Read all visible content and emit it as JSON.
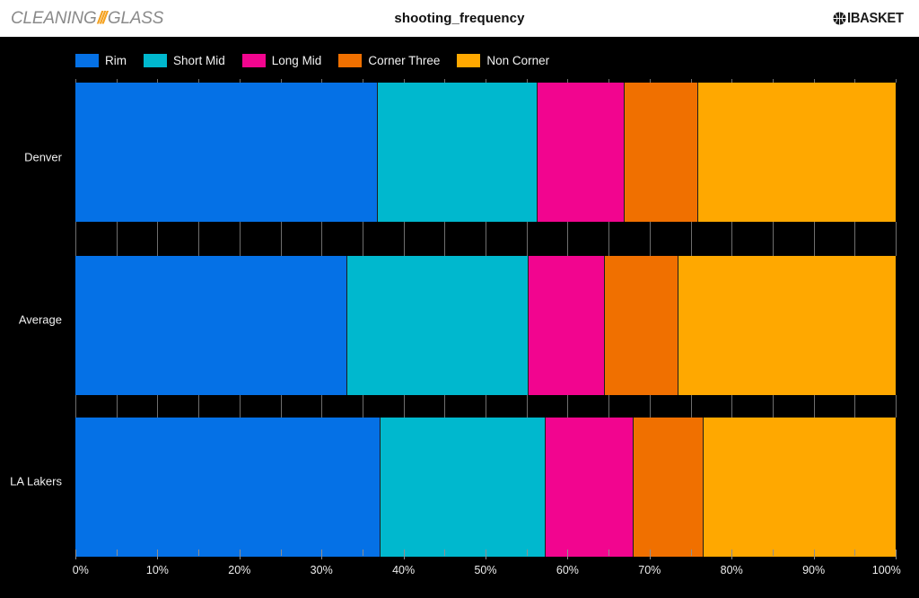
{
  "header": {
    "logo_left": {
      "name": "cleaning-glass-logo",
      "word1": "CLEANING",
      "slashes": "///",
      "word2": "GLASS",
      "slash_color": "#f5a11e",
      "text_color": "#8a8a8a"
    },
    "title": "shooting_frequency",
    "logo_right": {
      "name": "ibasket-logo",
      "icon": "basketball-icon",
      "brand": "IBASKET"
    },
    "background": "#ffffff"
  },
  "legend": {
    "position": "top-left",
    "items": [
      {
        "label": "Rim",
        "color": "#0571e6"
      },
      {
        "label": "Short Mid",
        "color": "#00b8ce"
      },
      {
        "label": "Long Mid",
        "color": "#f2058f"
      },
      {
        "label": "Corner Three",
        "color": "#f07000"
      },
      {
        "label": "Non Corner",
        "color": "#ffa800"
      }
    ]
  },
  "chart_data": {
    "type": "bar",
    "orientation": "horizontal",
    "stacked": true,
    "normalized": true,
    "title": "shooting_frequency",
    "xlabel": "",
    "ylabel": "",
    "xlim": [
      0,
      100
    ],
    "grid": false,
    "background": "#000000",
    "categories": [
      "Denver",
      "Average",
      "LA Lakers"
    ],
    "xtick_labels": [
      "0%",
      "10%",
      "20%",
      "30%",
      "40%",
      "50%",
      "60%",
      "70%",
      "80%",
      "90%",
      "100%"
    ],
    "xtick_values": [
      0,
      10,
      20,
      30,
      40,
      50,
      60,
      70,
      80,
      90,
      100
    ],
    "xtick_minor_values": [
      5,
      15,
      25,
      35,
      45,
      55,
      65,
      75,
      85,
      95
    ],
    "series": [
      {
        "name": "Rim",
        "color": "#0571e6",
        "values": [
          36.9,
          33.2,
          37.2
        ]
      },
      {
        "name": "Short Mid",
        "color": "#00b8ce",
        "values": [
          19.5,
          22.0,
          20.1
        ]
      },
      {
        "name": "Long Mid",
        "color": "#f2058f",
        "values": [
          10.6,
          9.3,
          10.8
        ]
      },
      {
        "name": "Corner Three",
        "color": "#f07000",
        "values": [
          8.9,
          9.0,
          8.5
        ]
      },
      {
        "name": "Non Corner",
        "color": "#ffa800",
        "values": [
          24.1,
          26.5,
          23.4
        ]
      }
    ]
  }
}
